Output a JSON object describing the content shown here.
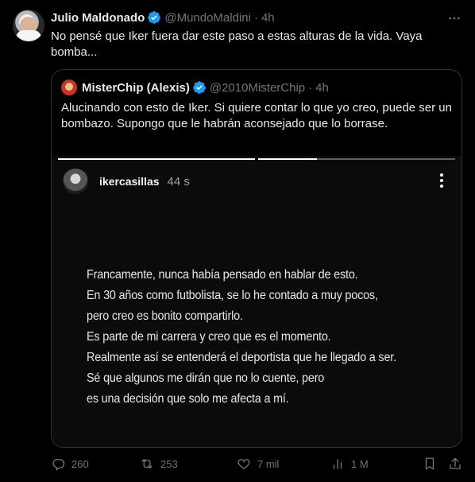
{
  "tweet": {
    "author_name": "Julio Maldonado",
    "handle": "@MundoMaldini",
    "time": "4h",
    "text": "No pensé que Iker fuera dar este paso a estas alturas de la vida. Vaya bomba...",
    "avatar_icon": "user-avatar",
    "verified_icon": "verified-badge-icon",
    "more_icon": "more-horizontal-icon"
  },
  "quote": {
    "author_name": "MisterChip (Alexis)",
    "handle": "@2010MisterChip",
    "time": "4h",
    "text": "Alucinando con esto de Iker. Si quiere contar lo que yo creo, puede ser un bombazo. Supongo que le habrán aconsejado que lo borrase."
  },
  "story": {
    "username": "ikercasillas",
    "time": "44 s",
    "progress_bar_fill": [
      1,
      0.3
    ],
    "lines": [
      "Francamente, nunca había pensado en hablar de esto.",
      "En 30 años como futbolista, se lo he contado a muy pocos,",
      "pero creo es bonito compartirlo.",
      "Es parte de mi carrera y creo que es el momento.",
      "Realmente así se entenderá el deportista que he llegado a ser.",
      "Sé que algunos me dirán que no lo cuente, pero",
      "es una decisión que solo me afecta a mí."
    ]
  },
  "actions": {
    "replies": "260",
    "reposts": "253",
    "likes": "7 mil",
    "views": "1 M"
  },
  "colors": {
    "background": "#000000",
    "text": "#e7e9ea",
    "muted": "#71767b",
    "verified": "#1d9bf0",
    "border": "#2f3336"
  }
}
